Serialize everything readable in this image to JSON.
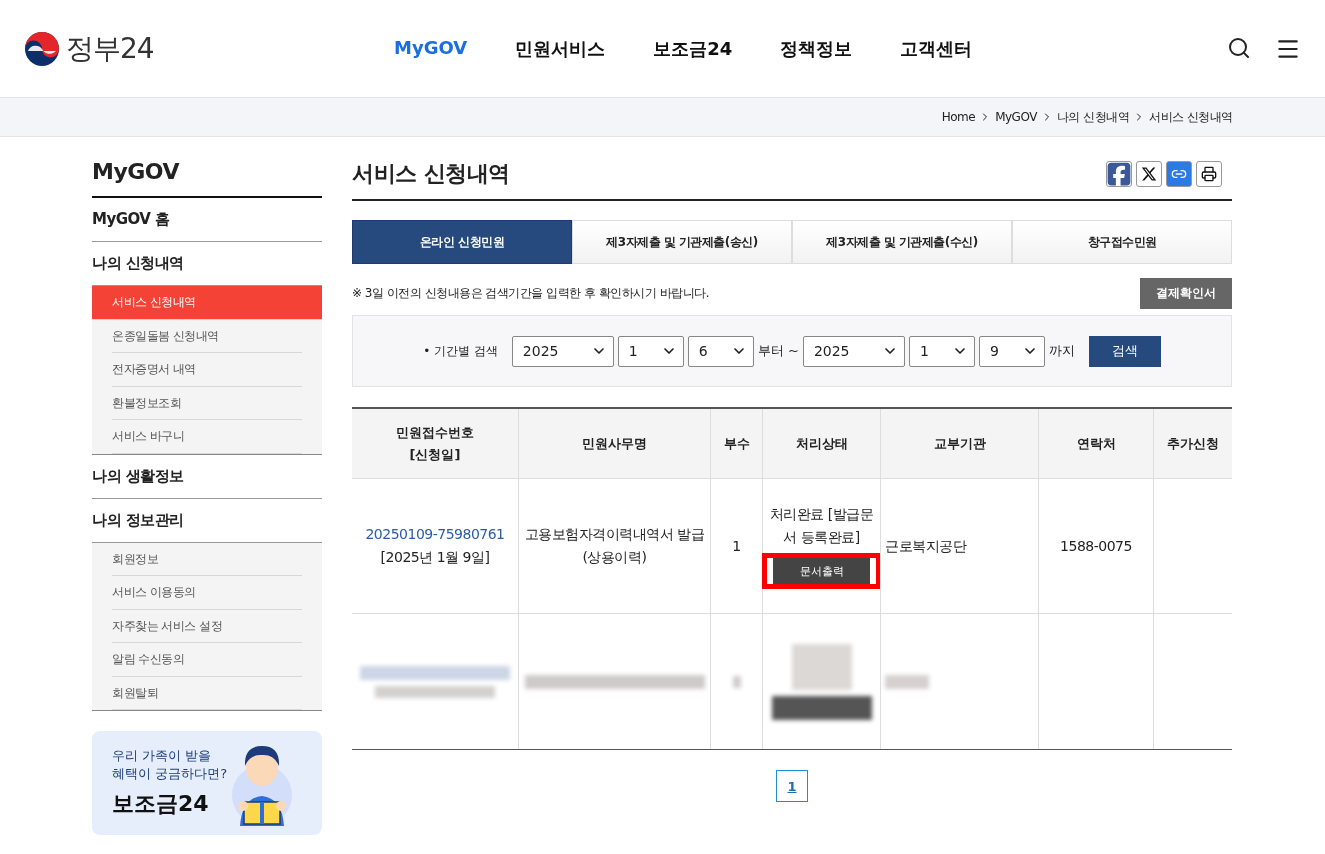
{
  "header": {
    "logo": "정부24",
    "nav": [
      {
        "label": "MyGOV",
        "selected": true
      },
      {
        "label": "민원서비스",
        "selected": false
      },
      {
        "label": "보조금24",
        "selected": false
      },
      {
        "label": "정책정보",
        "selected": false
      },
      {
        "label": "고객센터",
        "selected": false
      }
    ]
  },
  "breadcrumb": [
    "Home",
    "MyGOV",
    "나의 신청내역",
    "서비스 신청내역"
  ],
  "sidebar": {
    "title": "MyGOV",
    "sections": [
      {
        "label": "MyGOV 홈"
      },
      {
        "label": "나의 신청내역",
        "children": [
          {
            "label": "서비스 신청내역",
            "selected": true
          },
          {
            "label": "온종일돌봄 신청내역",
            "selected": false
          },
          {
            "label": "전자증명서 내역",
            "selected": false
          },
          {
            "label": "환불정보조회",
            "selected": false
          },
          {
            "label": "서비스 바구니",
            "selected": false
          }
        ]
      },
      {
        "label": "나의 생활정보"
      },
      {
        "label": "나의 정보관리",
        "children": [
          {
            "label": "회원정보",
            "selected": false
          },
          {
            "label": "서비스 이용동의",
            "selected": false
          },
          {
            "label": "자주찾는 서비스 설정",
            "selected": false
          },
          {
            "label": "알림 수신동의",
            "selected": false
          },
          {
            "label": "회원탈퇴",
            "selected": false
          }
        ]
      }
    ]
  },
  "banner": {
    "lines": [
      "우리 가족이 받을",
      "혜택이 궁금하다면?"
    ],
    "title": "보조금24"
  },
  "page_title": "서비스 신청내역",
  "tabs": [
    {
      "label": "온라인 신청민원",
      "selected": true
    },
    {
      "label": "제3자제출 및 기관제출(송신)",
      "selected": false
    },
    {
      "label": "제3자제출 및 기관제출(수신)",
      "selected": false
    },
    {
      "label": "창구접수민원",
      "selected": false
    }
  ],
  "notice": "※ 3일 이전의 신청내용은 검색기간을 입력한 후 확인하시기 바랍니다.",
  "receipt_button": "결제확인서",
  "search": {
    "label": "• 기간별 검색",
    "from": [
      "2025",
      "1",
      "6"
    ],
    "from_suffix": "부터 ~",
    "to": [
      "2025",
      "1",
      "9"
    ],
    "to_suffix": "까지",
    "button": "검색"
  },
  "table": {
    "columns": [
      "민원접수번호\n[신청일]",
      "민원사무명",
      "부수",
      "처리상태",
      "교부기관",
      "연락처",
      "추가신청"
    ],
    "rows": [
      {
        "kind": "data",
        "number": "20250109-75980761",
        "date": "[2025년 1월 9일]",
        "service": "고용보험자격이력내역서 발급(상용이력)",
        "copies": "1",
        "status": "처리완료 [발급문서 등록완료]",
        "action": "문서출력",
        "highlighted": true,
        "agency": "근로복지공단",
        "contact": "1588-0075"
      },
      {
        "kind": "redacted"
      }
    ]
  },
  "pagination": [
    {
      "label": "1",
      "selected": true
    }
  ]
}
